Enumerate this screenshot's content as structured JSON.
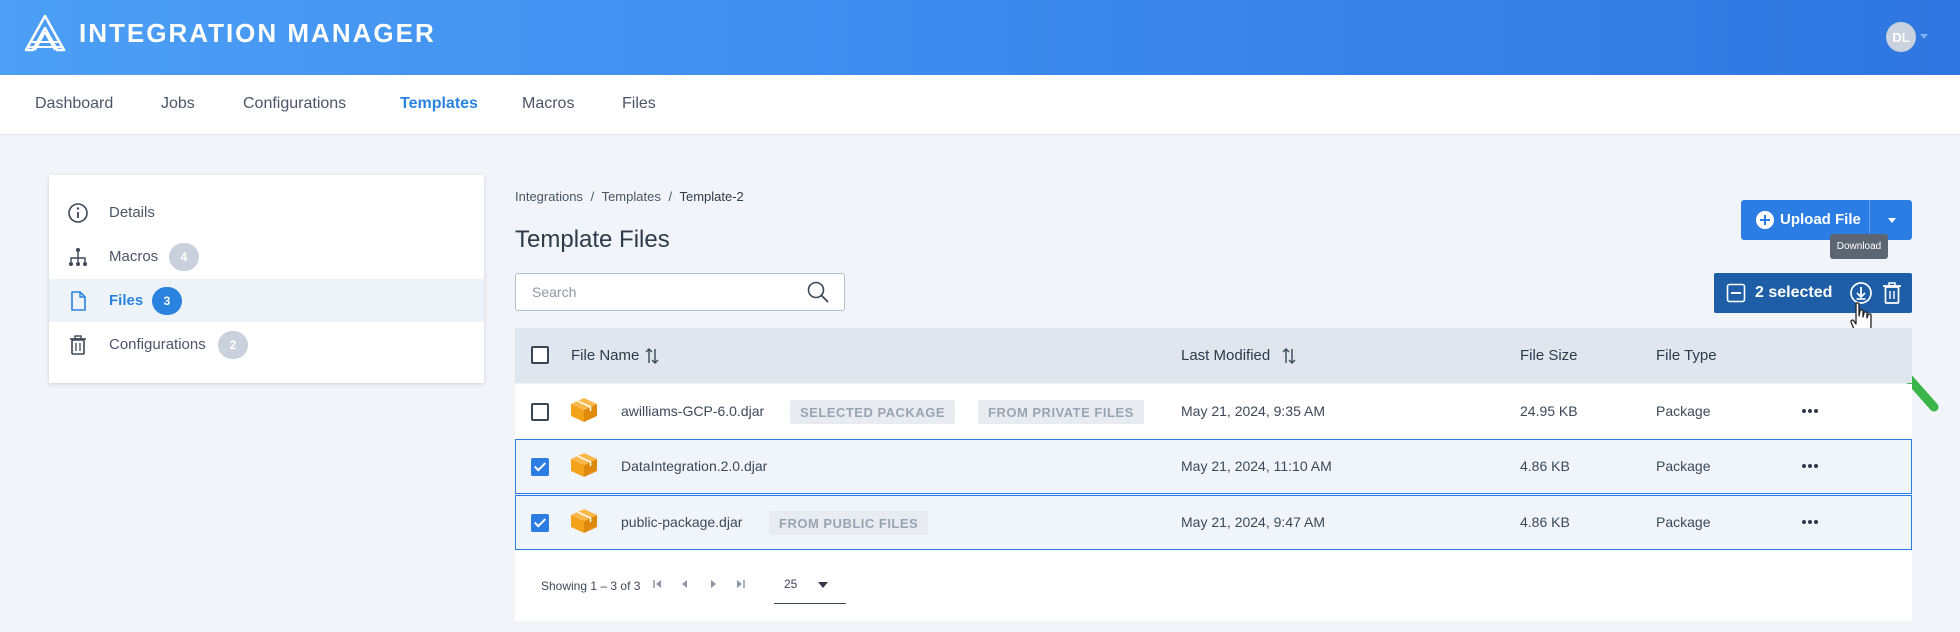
{
  "header": {
    "app_title": "INTEGRATION MANAGER",
    "avatar_initials": "DL"
  },
  "nav": {
    "tabs": [
      {
        "label": "Dashboard",
        "active": false
      },
      {
        "label": "Jobs",
        "active": false
      },
      {
        "label": "Configurations",
        "active": false
      },
      {
        "label": "Templates",
        "active": true
      },
      {
        "label": "Macros",
        "active": false
      },
      {
        "label": "Files",
        "active": false
      }
    ]
  },
  "side_panel": {
    "items": [
      {
        "label": "Details",
        "icon": "info-icon",
        "count": null,
        "active": false
      },
      {
        "label": "Macros",
        "icon": "hierarchy-icon",
        "count": "4",
        "active": false
      },
      {
        "label": "Files",
        "icon": "file-icon",
        "count": "3",
        "active": true
      },
      {
        "label": "Configurations",
        "icon": "trash-icon",
        "count": "2",
        "active": false
      }
    ]
  },
  "breadcrumb": {
    "items": [
      "Integrations",
      "Templates"
    ],
    "separator": "/",
    "current": "Template-2"
  },
  "page_title": "Template Files",
  "search": {
    "placeholder": "Search",
    "value": ""
  },
  "upload": {
    "label": "Upload File"
  },
  "tooltip": {
    "text": "Download"
  },
  "selection": {
    "label": "2 selected"
  },
  "table": {
    "columns": {
      "file_name": "File Name",
      "last_modified": "Last Modified",
      "file_size": "File Size",
      "file_type": "File Type"
    },
    "rows": [
      {
        "checked": false,
        "file_name": "awilliams-GCP-6.0.djar",
        "tags": [
          "SELECTED PACKAGE",
          "FROM PRIVATE FILES"
        ],
        "last_modified": "May 21, 2024, 9:35 AM",
        "file_size": "24.95 KB",
        "file_type": "Package"
      },
      {
        "checked": true,
        "file_name": "DataIntegration.2.0.djar",
        "tags": [],
        "last_modified": "May 21, 2024, 11:10 AM",
        "file_size": "4.86 KB",
        "file_type": "Package"
      },
      {
        "checked": true,
        "file_name": "public-package.djar",
        "tags": [
          "FROM PUBLIC FILES"
        ],
        "last_modified": "May 21, 2024, 9:47 AM",
        "file_size": "4.86 KB",
        "file_type": "Package"
      }
    ]
  },
  "pager": {
    "showing": "Showing 1 – 3 of 3",
    "page_size": "25"
  },
  "colors": {
    "header_start": "#4c9ff5",
    "header_end": "#2f76e0",
    "accent": "#2b7de4",
    "selection_bar": "#1e5ea6",
    "package_orange": "#f5a21b",
    "annotation_arrow": "#3bb54a"
  }
}
